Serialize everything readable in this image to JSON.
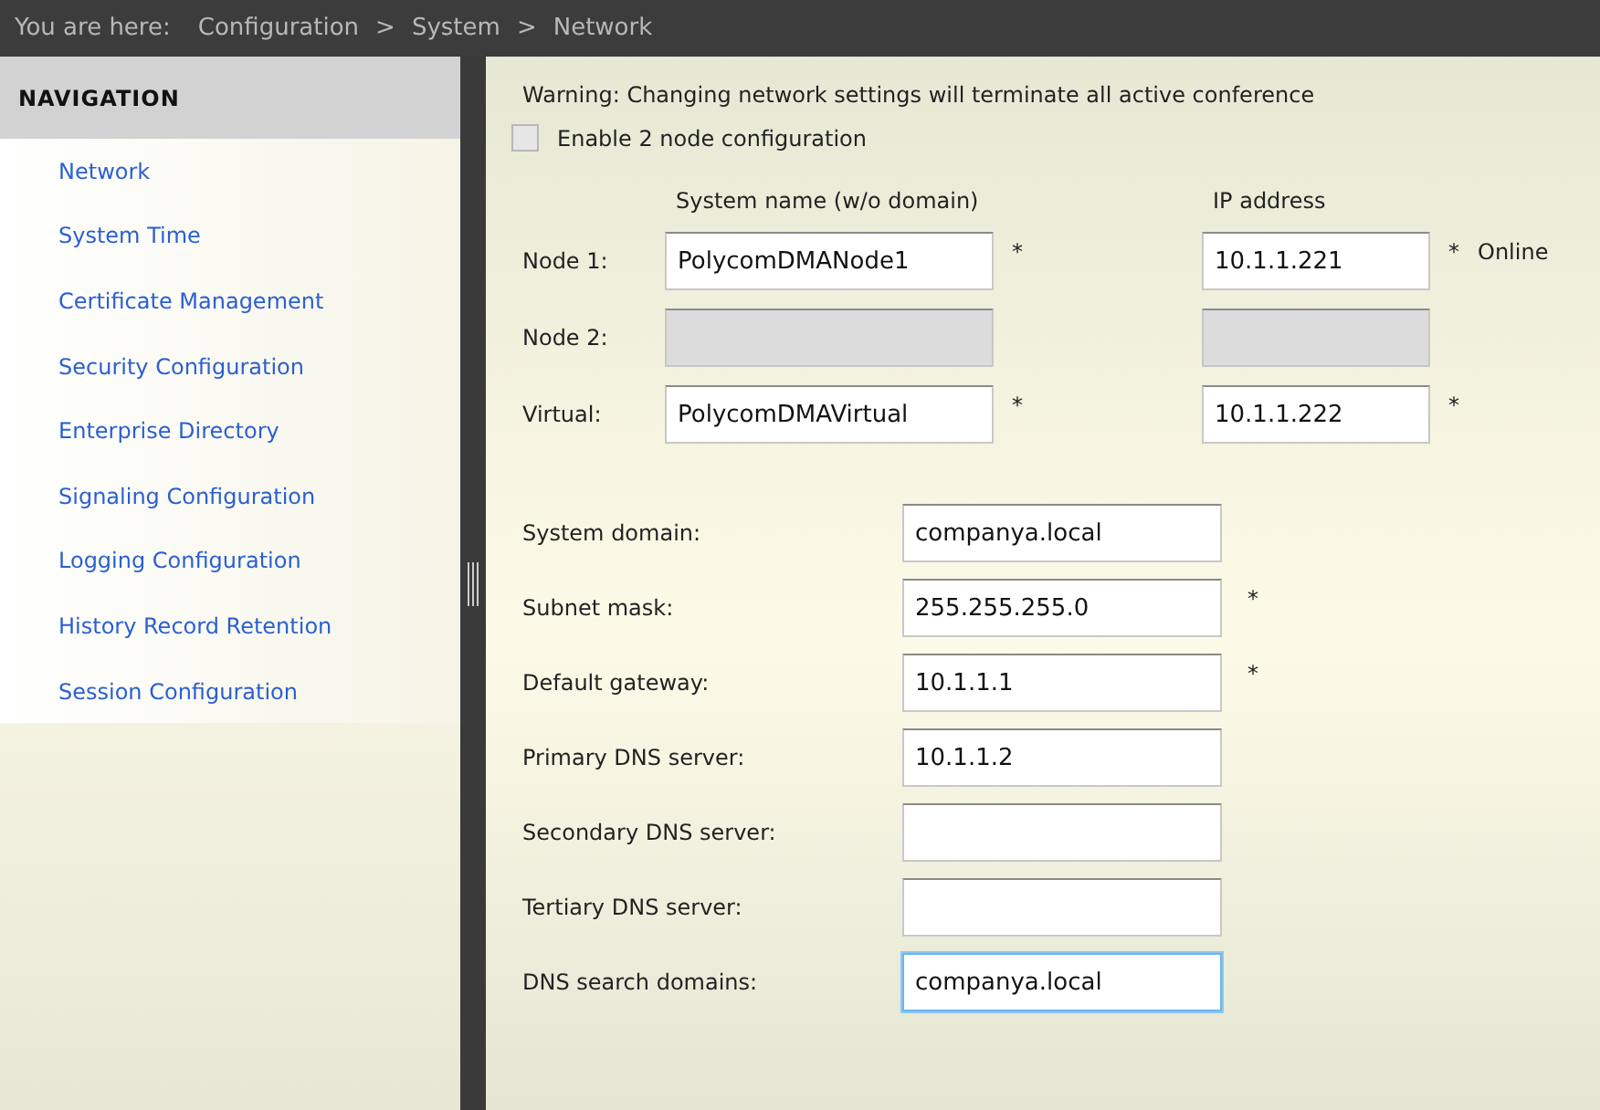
{
  "breadcrumb": {
    "label": "You are here:",
    "items": [
      "Configuration",
      "System",
      "Network"
    ],
    "separator": ">"
  },
  "navigation": {
    "title": "NAVIGATION",
    "items": [
      "Network",
      "System Time",
      "Certificate Management",
      "Security Configuration",
      "Enterprise Directory",
      "Signaling Configuration",
      "Logging Configuration",
      "History Record Retention",
      "Session Configuration"
    ]
  },
  "warning": "Warning: Changing network settings will terminate all active conference",
  "two_node": {
    "label": "Enable 2 node configuration",
    "checked": false
  },
  "node_table": {
    "columns": [
      "System name (w/o domain)",
      "IP address"
    ],
    "rows": [
      {
        "label": "Node 1:",
        "name": "PolycomDMANode1",
        "name_mark": "*",
        "ip": "10.1.1.221",
        "ip_mark": "*",
        "status": "Online",
        "disabled": false
      },
      {
        "label": "Node 2:",
        "disabled": true
      },
      {
        "label": "Virtual:",
        "name": "PolycomDMAVirtual",
        "name_mark": "*",
        "ip": "10.1.1.222",
        "ip_mark": "*",
        "disabled": false
      }
    ]
  },
  "fields": [
    {
      "label": "System domain:",
      "value": "companya.local",
      "focused": false
    },
    {
      "label": "Subnet mask:",
      "value": "255.255.255.0",
      "mark": "*",
      "focused": false
    },
    {
      "label": "Default gateway:",
      "value": "10.1.1.1",
      "mark": "*",
      "focused": false
    },
    {
      "label": "Primary DNS server:",
      "value": "10.1.1.2",
      "focused": false
    },
    {
      "label": "Secondary DNS server:",
      "focused": false
    },
    {
      "label": "Tertiary DNS server:",
      "focused": false
    },
    {
      "label": "DNS search domains:",
      "value": "companya.local",
      "focused": true
    }
  ]
}
